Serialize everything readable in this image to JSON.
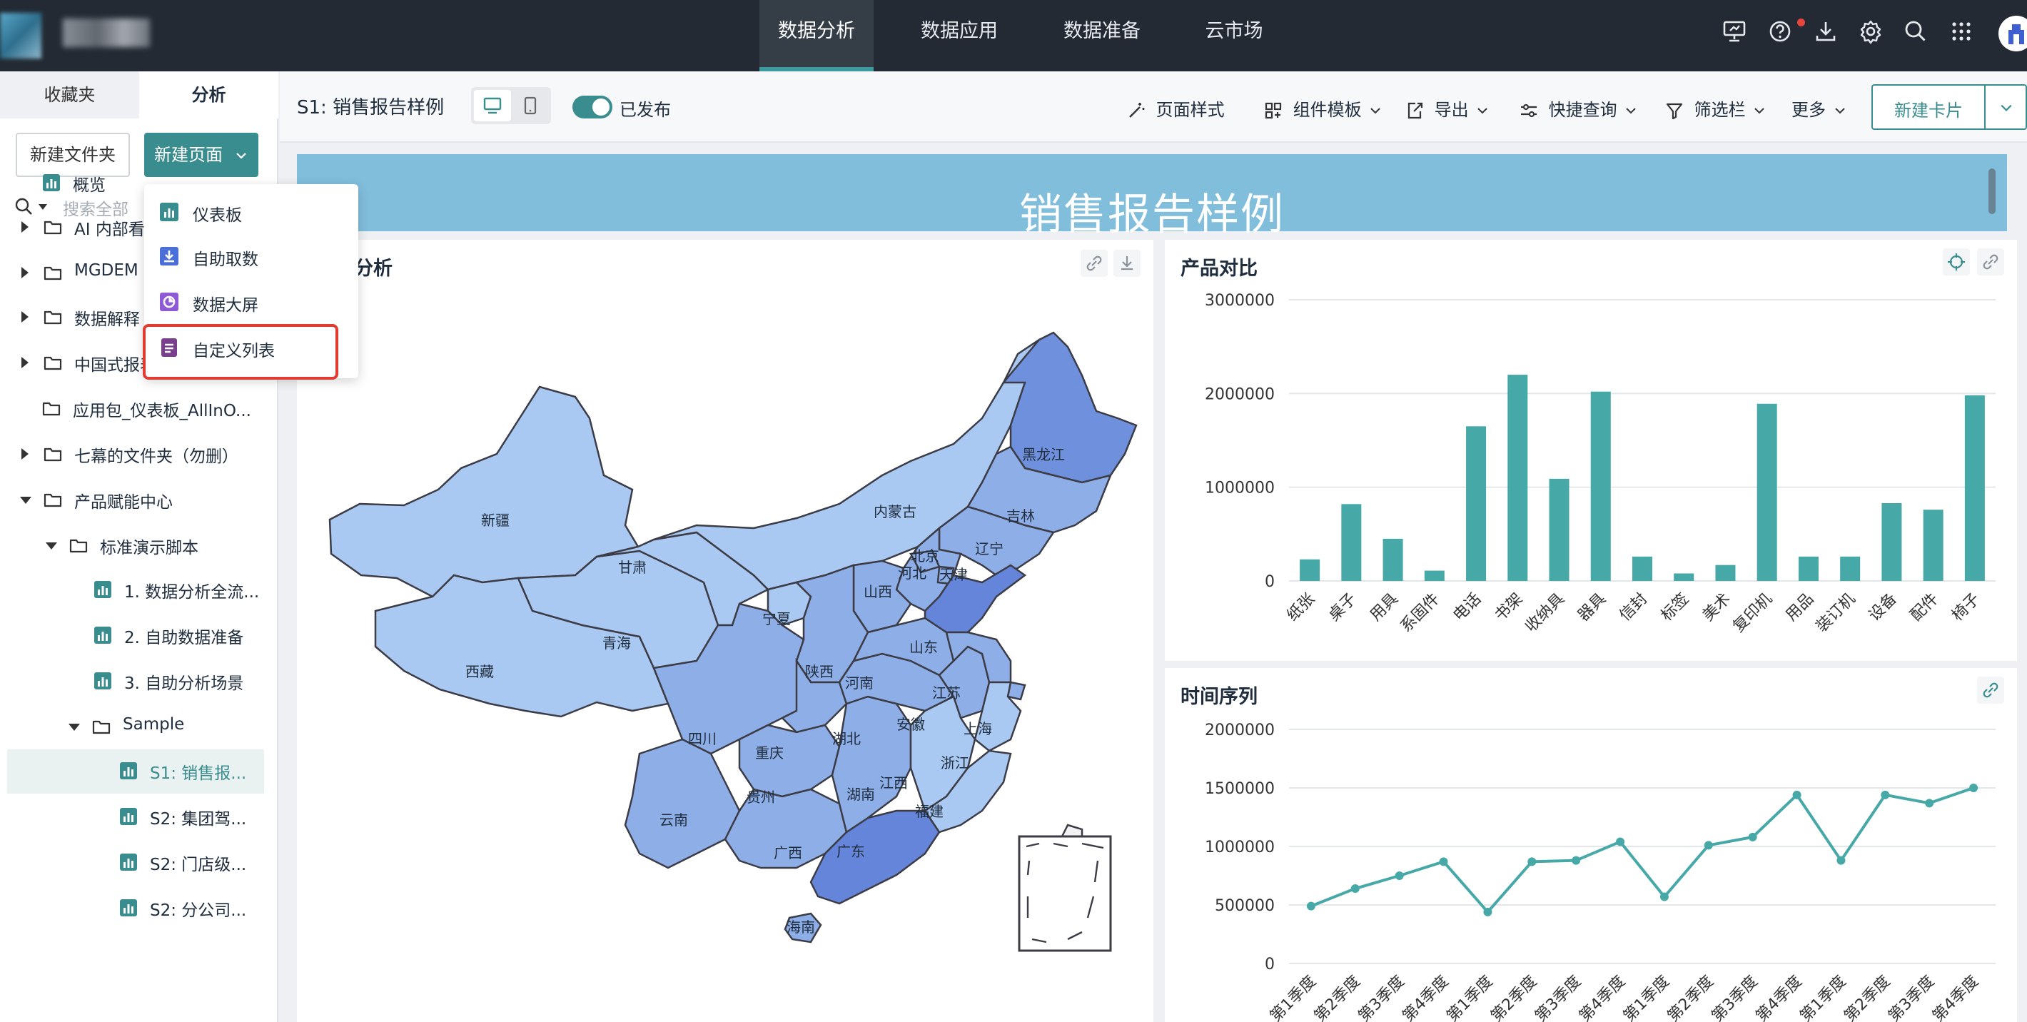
{
  "top_nav": {
    "tabs": [
      {
        "label": "数据分析",
        "active": true
      },
      {
        "label": "数据应用",
        "active": false
      },
      {
        "label": "数据准备",
        "active": false
      },
      {
        "label": "云市场",
        "active": false
      }
    ],
    "icons": [
      "presentation-icon",
      "help-icon",
      "download-icon",
      "settings-icon",
      "search-icon",
      "apps-grid-icon",
      "avatar"
    ]
  },
  "sidebar": {
    "tabs": {
      "favorites": "收藏夹",
      "analysis": "分析"
    },
    "new_folder": "新建文件夹",
    "new_page": "新建页面",
    "search_placeholder": "搜索全部",
    "tree": [
      {
        "label": "概览",
        "type": "dashboard"
      },
      {
        "label": "AI 内部看",
        "type": "folder"
      },
      {
        "label": "MGDEM",
        "type": "folder"
      },
      {
        "label": "数据解释",
        "type": "folder"
      },
      {
        "label": "中国式报表Pro（示例）",
        "type": "folder"
      },
      {
        "label": "应用包_仪表板_AllInO...",
        "type": "folder"
      },
      {
        "label": "七幕的文件夹（勿删）",
        "type": "folder"
      },
      {
        "label": "产品赋能中心",
        "type": "folder"
      },
      {
        "label": "标准演示脚本",
        "type": "folder"
      },
      {
        "label": "1. 数据分析全流...",
        "type": "dashboard"
      },
      {
        "label": "2. 自助数据准备",
        "type": "dashboard"
      },
      {
        "label": "3. 自助分析场景",
        "type": "dashboard"
      },
      {
        "label": "Sample",
        "type": "folder"
      },
      {
        "label": "S1:  销售报...",
        "type": "dashboard",
        "selected": true
      },
      {
        "label": "S2: 集团驾...",
        "type": "dashboard"
      },
      {
        "label": "S2: 门店级...",
        "type": "dashboard"
      },
      {
        "label": "S2: 分公司...",
        "type": "dashboard"
      }
    ]
  },
  "new_page_menu": {
    "items": [
      {
        "label": "仪表板",
        "color": "#3a8d8e"
      },
      {
        "label": "自助取数",
        "color": "#4a6fd8"
      },
      {
        "label": "数据大屏",
        "color": "#8f5ad6"
      },
      {
        "label": "自定义列表",
        "color": "#7a3f8c",
        "highlighted": true
      }
    ]
  },
  "toolbar": {
    "title": "S1:  销售报告样例",
    "published_label": "已发布",
    "page_style": "页面样式",
    "component_template": "组件模板",
    "export": "导出",
    "quick_query": "快捷查询",
    "filter_bar": "筛选栏",
    "more": "更多",
    "new_card": "新建卡片"
  },
  "banner": {
    "title": "销售报告样例"
  },
  "map_card": {
    "title": "分析",
    "provinces": [
      "新疆",
      "西藏",
      "青海",
      "甘肃",
      "内蒙古",
      "黑龙江",
      "吉林",
      "辽宁",
      "北京",
      "天津",
      "河北",
      "山西",
      "宁夏",
      "陕西",
      "四川",
      "重庆",
      "云南",
      "贵州",
      "广西",
      "广东",
      "海南",
      "湖南",
      "湖北",
      "河南",
      "山东",
      "安徽",
      "江苏",
      "上海",
      "浙江",
      "江西",
      "福建"
    ]
  },
  "colors": {
    "accent": "#3a8d8e",
    "bar": "#47a8a8",
    "banner": "#80bedc",
    "map_light": "#a9c8f2",
    "map_mid": "#8eaee8",
    "map_dark": "#6485da"
  },
  "chart_data": [
    {
      "type": "bar",
      "title": "产品对比",
      "categories": [
        "纸张",
        "桌子",
        "用具",
        "系固件",
        "电话",
        "书架",
        "收纳具",
        "器具",
        "信封",
        "标签",
        "美术",
        "复印机",
        "用品",
        "装订机",
        "设备",
        "配件",
        "椅子"
      ],
      "values": [
        230000,
        820000,
        450000,
        110000,
        1650000,
        2200000,
        1090000,
        2020000,
        260000,
        80000,
        170000,
        1890000,
        260000,
        260000,
        830000,
        760000,
        1980000
      ],
      "y_ticks": [
        "3000000",
        "2000000",
        "1000000",
        "0"
      ],
      "ylim": [
        0,
        3000000
      ],
      "grid": true
    },
    {
      "type": "line",
      "title": "时间序列",
      "categories": [
        "第1季度",
        "第2季度",
        "第3季度",
        "第4季度",
        "第1季度",
        "第2季度",
        "第3季度",
        "第4季度",
        "第1季度",
        "第2季度",
        "第3季度",
        "第4季度",
        "第1季度",
        "第2季度",
        "第3季度",
        "第4季度"
      ],
      "values": [
        490000,
        640000,
        750000,
        870000,
        440000,
        870000,
        880000,
        1040000,
        570000,
        1010000,
        1080000,
        1440000,
        880000,
        1440000,
        1370000,
        1500000
      ],
      "y_ticks": [
        "2000000",
        "1500000",
        "1000000",
        "500000",
        "0"
      ],
      "ylim": [
        0,
        2000000
      ],
      "grid": true
    }
  ]
}
